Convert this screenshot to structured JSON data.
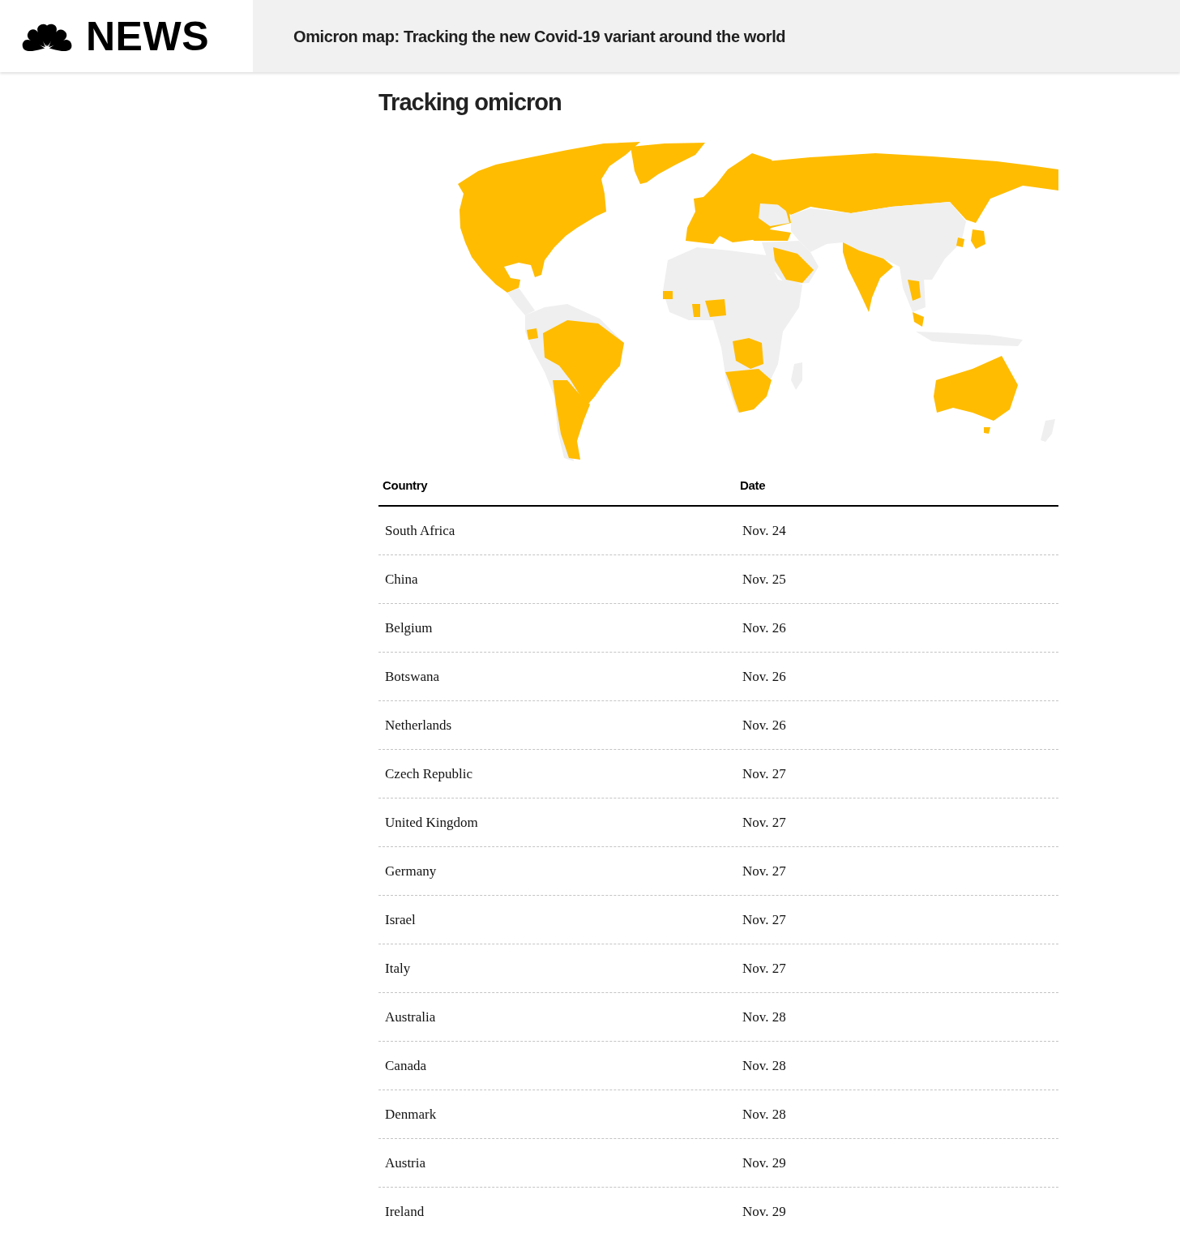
{
  "header": {
    "logo_text": "NEWS",
    "title": "Omicron map: Tracking the new Covid-19 variant around the world"
  },
  "section": {
    "heading": "Tracking omicron"
  },
  "table": {
    "columns": [
      "Country",
      "Date"
    ],
    "rows": [
      [
        "South Africa",
        "Nov. 24"
      ],
      [
        "China",
        "Nov. 25"
      ],
      [
        "Belgium",
        "Nov. 26"
      ],
      [
        "Botswana",
        "Nov. 26"
      ],
      [
        "Netherlands",
        "Nov. 26"
      ],
      [
        "Czech Republic",
        "Nov. 27"
      ],
      [
        "United Kingdom",
        "Nov. 27"
      ],
      [
        "Germany",
        "Nov. 27"
      ],
      [
        "Israel",
        "Nov. 27"
      ],
      [
        "Italy",
        "Nov. 27"
      ],
      [
        "Australia",
        "Nov. 28"
      ],
      [
        "Canada",
        "Nov. 28"
      ],
      [
        "Denmark",
        "Nov. 28"
      ],
      [
        "Austria",
        "Nov. 29"
      ],
      [
        "Ireland",
        "Nov. 29"
      ]
    ]
  }
}
